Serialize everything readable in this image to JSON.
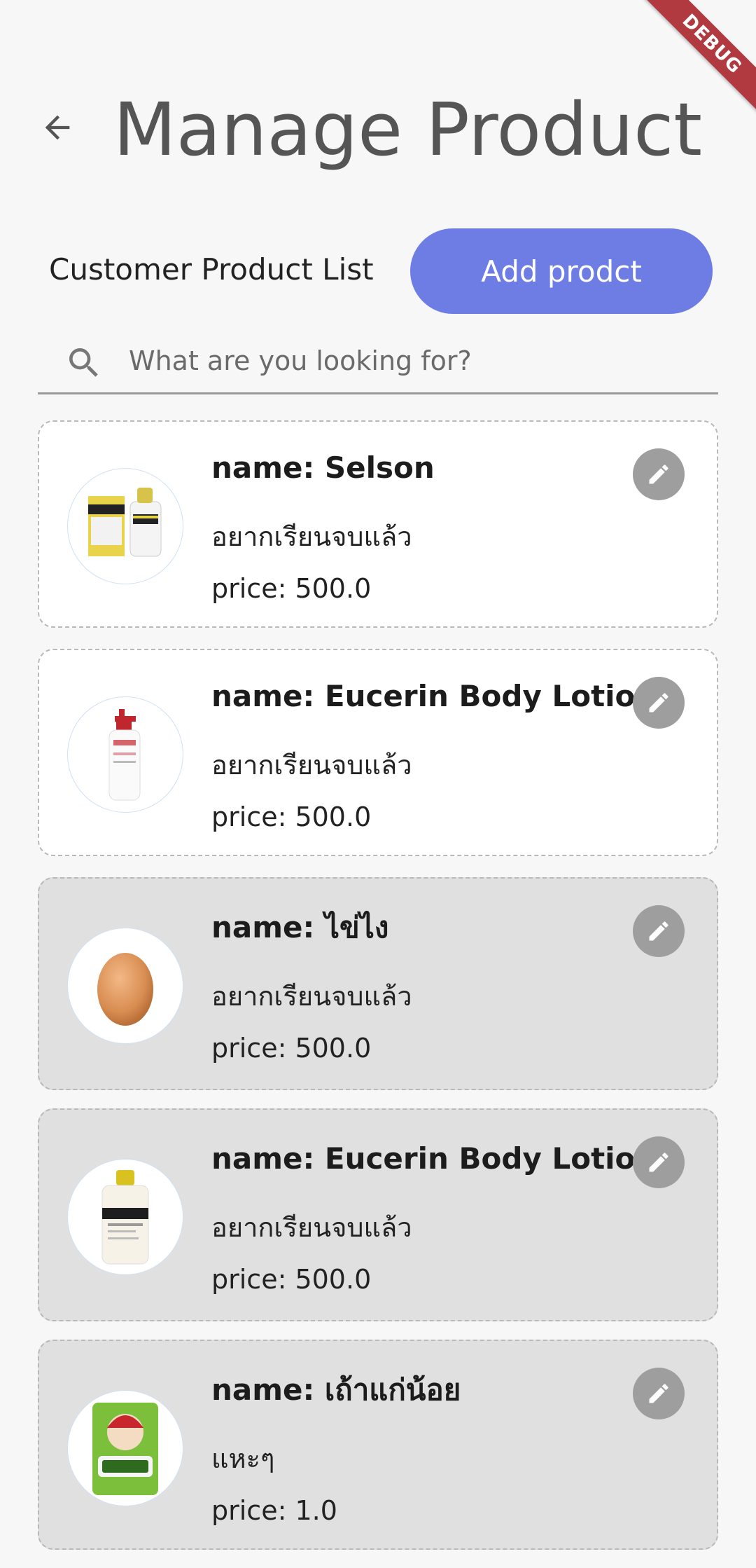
{
  "debug_banner": "DEBUG",
  "header": {
    "back_icon": "arrow-back-icon",
    "title": "Manage Product"
  },
  "toolbar": {
    "list_label": "Customer Product List",
    "add_button_label": "Add prodct"
  },
  "search": {
    "icon": "search-icon",
    "placeholder": "What are you looking for?",
    "value": ""
  },
  "colors": {
    "accent": "#6d7de3",
    "edit_button": "#9e9e9e",
    "card_grey": "#e0e0e0",
    "debug_ribbon": "#b03a40"
  },
  "products": [
    {
      "name": "name: Selson",
      "description": "อยากเรียนจบแล้ว",
      "price": "price: 500.0",
      "image": "selsun-bottles",
      "edit_icon": "pencil-icon"
    },
    {
      "name": "name: Eucerin Body Lotion",
      "description": "อยากเรียนจบแล้ว",
      "price": "price: 500.0",
      "image": "eucerin-pump-bottle",
      "edit_icon": "pencil-icon"
    },
    {
      "name": "name: ไข่ไง",
      "description": "อยากเรียนจบแล้ว",
      "price": "price: 500.0",
      "image": "egg",
      "edit_icon": "pencil-icon"
    },
    {
      "name": "name: Eucerin Body Lotion",
      "description": "อยากเรียนจบแล้ว",
      "price": "price: 500.0",
      "image": "selsun-bottle",
      "edit_icon": "pencil-icon"
    },
    {
      "name": "name: เถ้าแก่น้อย",
      "description": "แหะๆ",
      "price": "price: 1.0",
      "image": "seaweed-snack-pack",
      "edit_icon": "pencil-icon"
    }
  ]
}
